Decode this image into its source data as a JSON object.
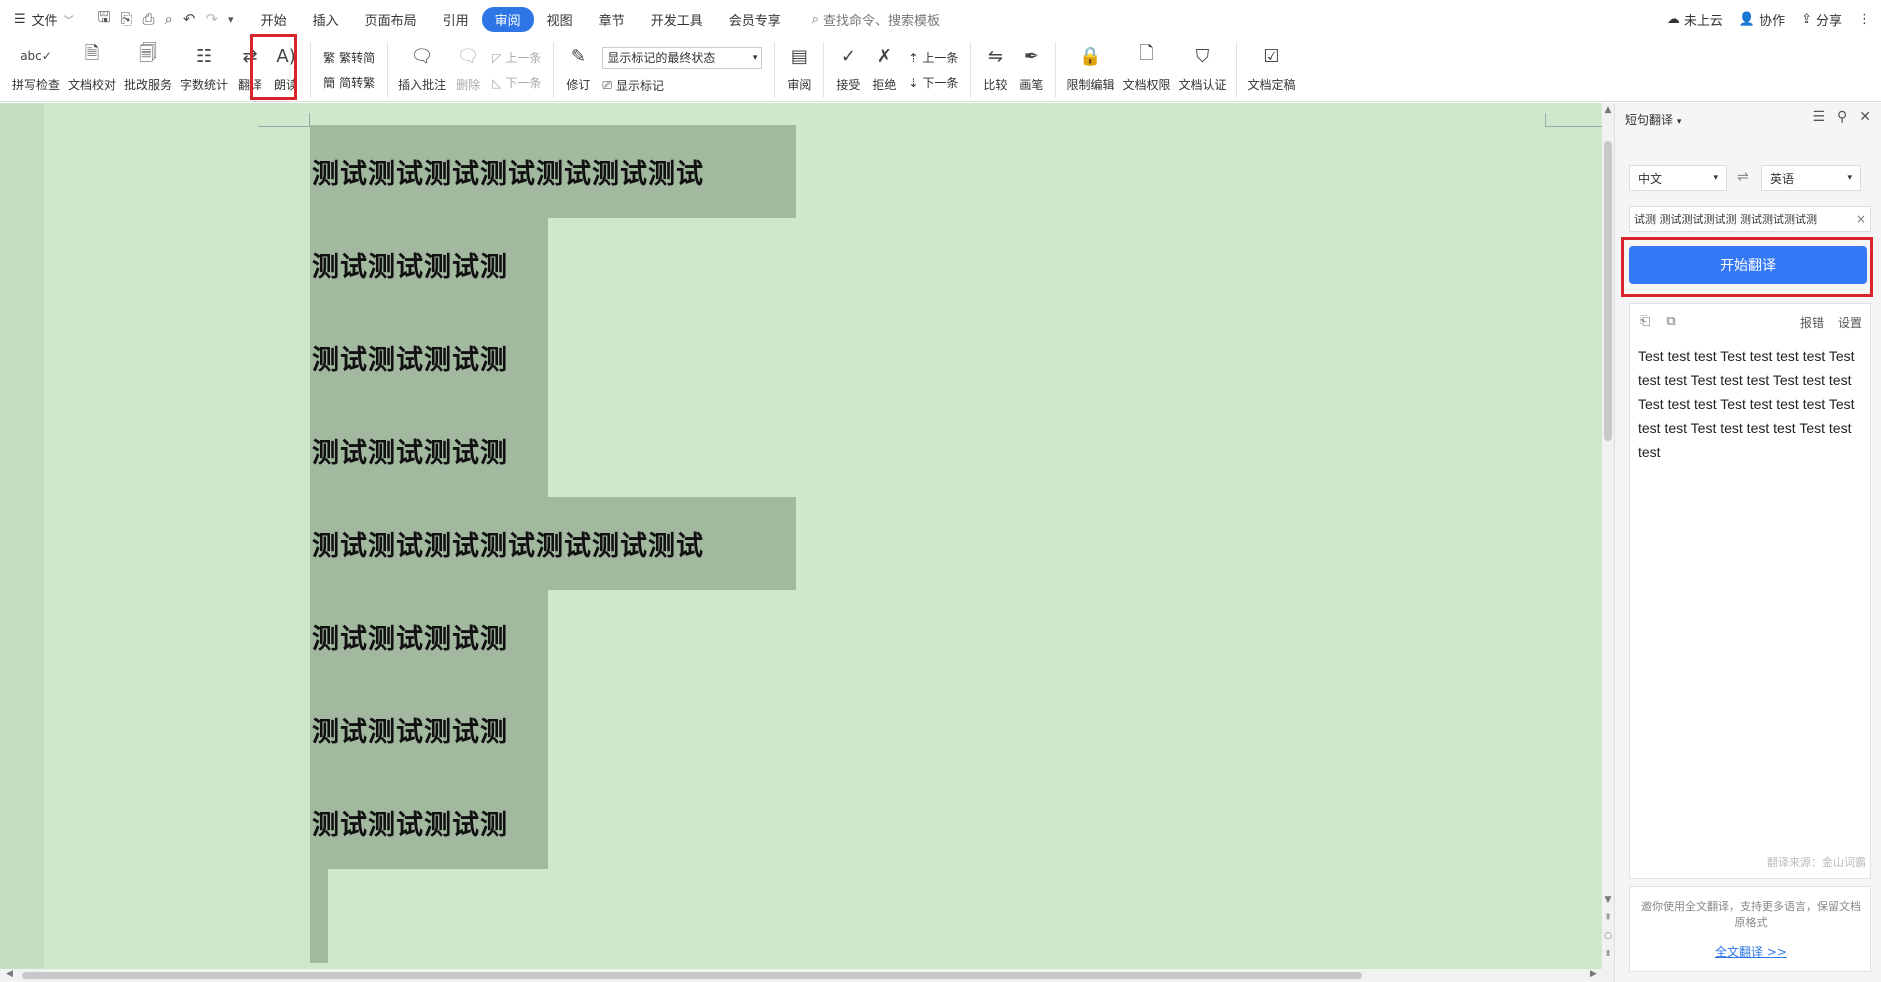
{
  "menubar": {
    "file_label": "文件",
    "tabs": [
      "开始",
      "插入",
      "页面布局",
      "引用",
      "审阅",
      "视图",
      "章节",
      "开发工具",
      "会员专享"
    ],
    "active_tab": "审阅",
    "search_placeholder": "查找命令、搜索模板",
    "right": {
      "cloud": "未上云",
      "collab": "协作",
      "share": "分享"
    }
  },
  "ribbon": {
    "spell_check": "拼写检查",
    "doc_proof": "文档校对",
    "revise_service": "批改服务",
    "word_count": "字数统计",
    "translate": "翻译",
    "read_aloud": "朗读",
    "trad_to_simp": "繁转简",
    "simp_to_trad": "简转繁",
    "insert_comment": "插入批注",
    "delete": "删除",
    "prev_comment": "上一条",
    "next_comment": "下一条",
    "track_changes": "修订",
    "markup_state": "显示标记的最终状态",
    "show_markup": "显示标记",
    "review": "审阅",
    "accept": "接受",
    "reject": "拒绝",
    "prev_change": "上一条",
    "next_change": "下一条",
    "compare": "比较",
    "ink": "画笔",
    "restrict_edit": "限制编辑",
    "doc_permission": "文档权限",
    "doc_certify": "文档认证",
    "doc_finalize": "文档定稿"
  },
  "document": {
    "lines": [
      "测试测试测试测试测试测试测试",
      "测试测试测试测",
      "测试测试测试测",
      "测试测试测试测",
      "测试测试测试测试测试测试测试",
      "测试测试测试测",
      "测试测试测试测",
      "测试测试测试测"
    ]
  },
  "panel": {
    "title": "短句翻译",
    "source_lang": "中文",
    "target_lang": "英语",
    "source_text": "试测 测试测试测试测 测试测试测试测",
    "translate_button": "开始翻译",
    "report": "报错",
    "settings": "设置",
    "result_text": "Test test test Test test test test Test test test Test test test Test test test Test test test Test test test test Test test test Test test test test Test test test",
    "source_note": "翻译来源：金山词霸",
    "promo_text": "邀你使用全文翻译，支持更多语言，保留文档原格式",
    "promo_link": "全文翻译 >>"
  },
  "colors": {
    "accent": "#2e76e6",
    "doc_background": "#cfe7cb",
    "selection": "#a2b9a0",
    "highlight_red": "#d9232d"
  }
}
